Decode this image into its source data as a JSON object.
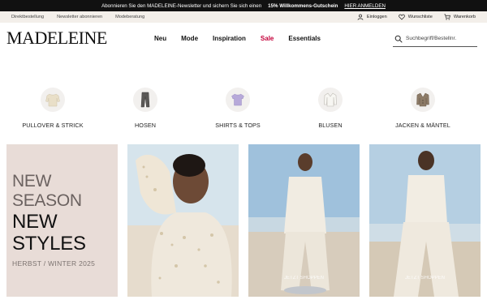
{
  "promo": {
    "text_before": "Abonnieren Sie den MADELEINE-Newsletter und sichern Sie sich einen",
    "highlight": "15% Willkommens-Gutschein",
    "cta": "HIER ANMELDEN"
  },
  "utility": {
    "links": [
      "Direktbestellung",
      "Newsletter abonnieren",
      "Modeberatung"
    ],
    "login": "Einloggen",
    "wishlist": "Wunschliste",
    "cart": "Warenkorb"
  },
  "header": {
    "logo": "MADELEINE",
    "nav": [
      "Neu",
      "Mode",
      "Inspiration",
      "Sale",
      "Essentials"
    ],
    "search_placeholder": "Suchbegriff/Bestellnr."
  },
  "categories": [
    {
      "label": "PULLOVER & STRICK",
      "icon": "sweater-icon"
    },
    {
      "label": "HOSEN",
      "icon": "trousers-icon"
    },
    {
      "label": "SHIRTS & TOPS",
      "icon": "shirt-icon"
    },
    {
      "label": "BLUSEN",
      "icon": "blouse-icon"
    },
    {
      "label": "JACKEN & MÄNTEL",
      "icon": "jacket-icon"
    }
  ],
  "hero": {
    "line1": "NEW",
    "line2": "SEASON",
    "line3": "NEW",
    "line4": "STYLES",
    "line5": "HERBST / WINTER 2025"
  },
  "tiles": {
    "tile3_caption": "JETZT SHOPPEN",
    "tile4_caption": "JETZT SHOPPEN"
  },
  "colors": {
    "sale": "#c4003a",
    "promo_bg": "#111111",
    "utility_bg": "#f3efea",
    "hero_bg": "#e8dcd7"
  }
}
